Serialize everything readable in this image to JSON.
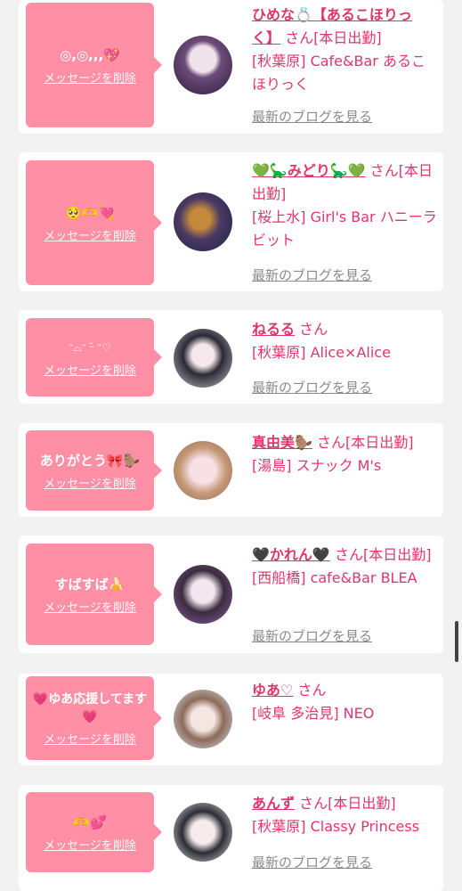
{
  "delete_label": "メッセージを削除",
  "blog_label": "最新のブログを見る",
  "cards": [
    {
      "message": "◎,◎,,,💖",
      "name": "ひめな💍【あるこほりっく】",
      "suffix": "さん[本日出勤]",
      "shop": "[秋葉原] Cafe&Bar あるこほりっく"
    },
    {
      "message": "🥺🫶💘",
      "name": "💚🦕みどり🦕💚",
      "suffix": "さん[本日出勤]",
      "shop": "[桜上水] Girl's Bar ハニーラビット"
    },
    {
      "message": "ᵔ⌓ᵔ ᵕ̈ ᵔ♡",
      "name": "ねるる",
      "suffix": "さん",
      "shop": "[秋葉原] Alice×Alice"
    },
    {
      "message": "ありがとう🎀🦫",
      "name": "真由美🦫",
      "suffix": "さん[本日出勤]",
      "shop": "[湯島] スナック M's"
    },
    {
      "message": "すばすば🍌",
      "name": "🖤かれん🖤",
      "suffix": "さん[本日出勤]",
      "shop": "[西船橋] cafe&Bar BLEA"
    },
    {
      "message": "💗ゆあ応援してます💗",
      "name": "ゆあ♡",
      "suffix": "さん",
      "shop": "[岐阜 多治見] NEO"
    },
    {
      "message": "🫶💕",
      "name": "あんず",
      "suffix": "さん[本日出勤]",
      "shop": "[秋葉原] Classy Princess"
    }
  ],
  "colors": {
    "accent": "#e0356c",
    "bubble": "#ff8fa5",
    "muted": "#8a8a8a"
  }
}
